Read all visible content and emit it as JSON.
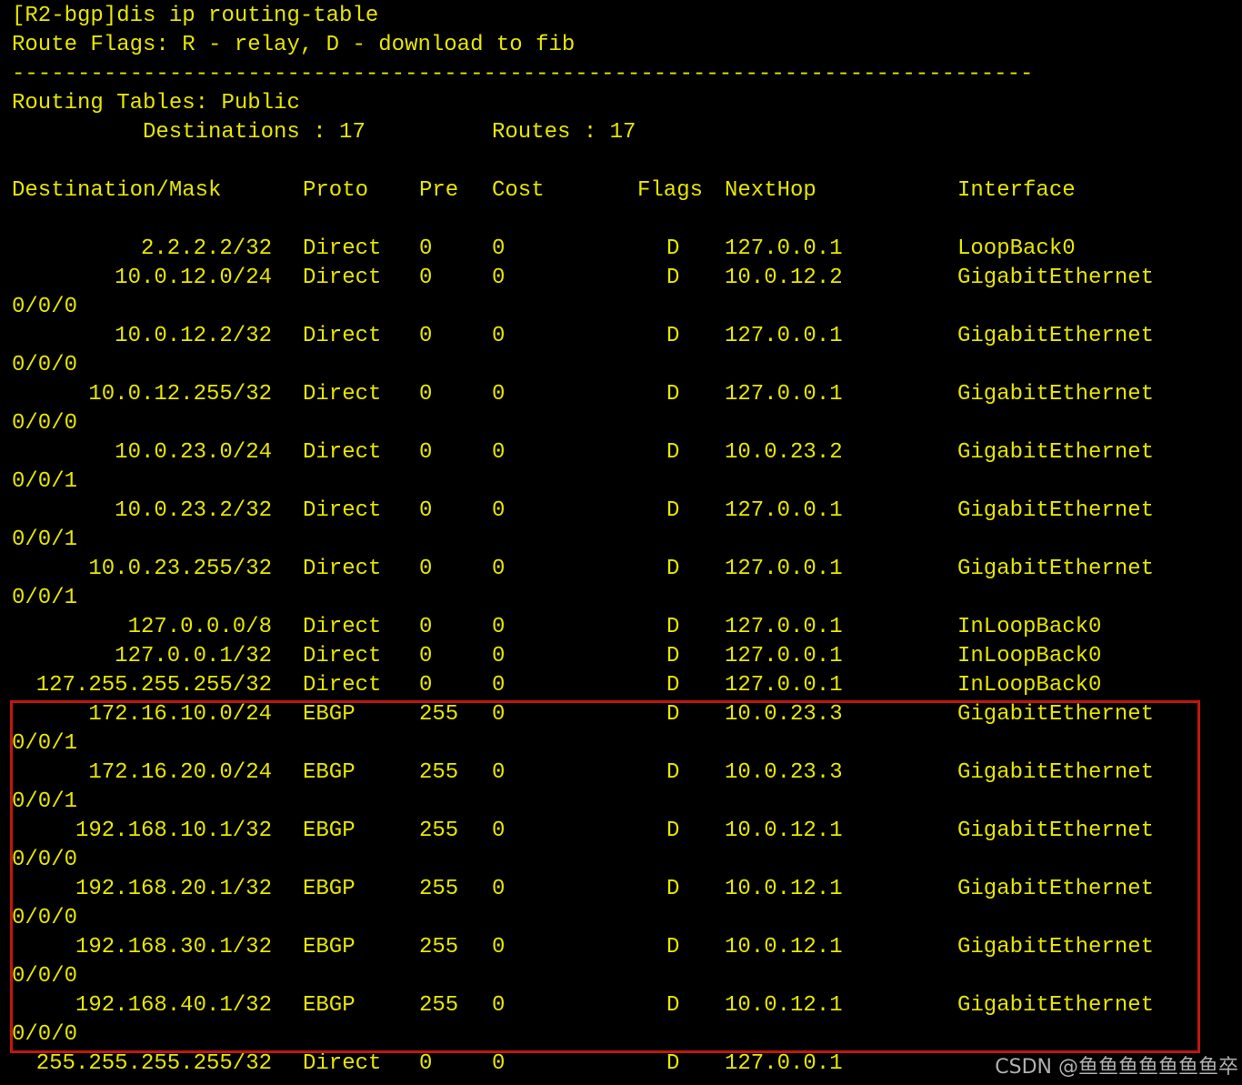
{
  "colors": {
    "background": "#000000",
    "text": "#e6e600",
    "highlight_border": "#c0170f",
    "watermark": "#b0b0b0"
  },
  "header": {
    "command": "[R2-bgp]dis ip routing-table",
    "flags_legend": "Route Flags: R - relay, D - download to fib",
    "separator": "------------------------------------------------------------------------------",
    "table_title": "Routing Tables: Public",
    "destinations_label": "Destinations : 17",
    "routes_label": "Routes : 17"
  },
  "columns": [
    "Destination/Mask",
    "Proto",
    "Pre",
    "Cost",
    "Flags",
    "NextHop",
    "Interface"
  ],
  "routes": [
    {
      "dest": "2.2.2.2/32",
      "proto": "Direct",
      "pre": "0",
      "cost": "0",
      "flags": "D",
      "nexthop": "127.0.0.1",
      "iface": "LoopBack0",
      "iface_cont": ""
    },
    {
      "dest": "10.0.12.0/24",
      "proto": "Direct",
      "pre": "0",
      "cost": "0",
      "flags": "D",
      "nexthop": "10.0.12.2",
      "iface": "GigabitEthernet",
      "iface_cont": "0/0/0"
    },
    {
      "dest": "10.0.12.2/32",
      "proto": "Direct",
      "pre": "0",
      "cost": "0",
      "flags": "D",
      "nexthop": "127.0.0.1",
      "iface": "GigabitEthernet",
      "iface_cont": "0/0/0"
    },
    {
      "dest": "10.0.12.255/32",
      "proto": "Direct",
      "pre": "0",
      "cost": "0",
      "flags": "D",
      "nexthop": "127.0.0.1",
      "iface": "GigabitEthernet",
      "iface_cont": "0/0/0"
    },
    {
      "dest": "10.0.23.0/24",
      "proto": "Direct",
      "pre": "0",
      "cost": "0",
      "flags": "D",
      "nexthop": "10.0.23.2",
      "iface": "GigabitEthernet",
      "iface_cont": "0/0/1"
    },
    {
      "dest": "10.0.23.2/32",
      "proto": "Direct",
      "pre": "0",
      "cost": "0",
      "flags": "D",
      "nexthop": "127.0.0.1",
      "iface": "GigabitEthernet",
      "iface_cont": "0/0/1"
    },
    {
      "dest": "10.0.23.255/32",
      "proto": "Direct",
      "pre": "0",
      "cost": "0",
      "flags": "D",
      "nexthop": "127.0.0.1",
      "iface": "GigabitEthernet",
      "iface_cont": "0/0/1"
    },
    {
      "dest": "127.0.0.0/8",
      "proto": "Direct",
      "pre": "0",
      "cost": "0",
      "flags": "D",
      "nexthop": "127.0.0.1",
      "iface": "InLoopBack0",
      "iface_cont": ""
    },
    {
      "dest": "127.0.0.1/32",
      "proto": "Direct",
      "pre": "0",
      "cost": "0",
      "flags": "D",
      "nexthop": "127.0.0.1",
      "iface": "InLoopBack0",
      "iface_cont": ""
    },
    {
      "dest": "127.255.255.255/32",
      "proto": "Direct",
      "pre": "0",
      "cost": "0",
      "flags": "D",
      "nexthop": "127.0.0.1",
      "iface": "InLoopBack0",
      "iface_cont": ""
    },
    {
      "dest": "172.16.10.0/24",
      "proto": "EBGP",
      "pre": "255",
      "cost": "0",
      "flags": "D",
      "nexthop": "10.0.23.3",
      "iface": "GigabitEthernet",
      "iface_cont": "0/0/1"
    },
    {
      "dest": "172.16.20.0/24",
      "proto": "EBGP",
      "pre": "255",
      "cost": "0",
      "flags": "D",
      "nexthop": "10.0.23.3",
      "iface": "GigabitEthernet",
      "iface_cont": "0/0/1"
    },
    {
      "dest": "192.168.10.1/32",
      "proto": "EBGP",
      "pre": "255",
      "cost": "0",
      "flags": "D",
      "nexthop": "10.0.12.1",
      "iface": "GigabitEthernet",
      "iface_cont": "0/0/0"
    },
    {
      "dest": "192.168.20.1/32",
      "proto": "EBGP",
      "pre": "255",
      "cost": "0",
      "flags": "D",
      "nexthop": "10.0.12.1",
      "iface": "GigabitEthernet",
      "iface_cont": "0/0/0"
    },
    {
      "dest": "192.168.30.1/32",
      "proto": "EBGP",
      "pre": "255",
      "cost": "0",
      "flags": "D",
      "nexthop": "10.0.12.1",
      "iface": "GigabitEthernet",
      "iface_cont": "0/0/0"
    },
    {
      "dest": "192.168.40.1/32",
      "proto": "EBGP",
      "pre": "255",
      "cost": "0",
      "flags": "D",
      "nexthop": "10.0.12.1",
      "iface": "GigabitEthernet",
      "iface_cont": "0/0/0"
    },
    {
      "dest": "255.255.255.255/32",
      "proto": "Direct",
      "pre": "0",
      "cost": "0",
      "flags": "D",
      "nexthop": "127.0.0.1",
      "iface": "",
      "iface_cont": ""
    }
  ],
  "watermark": "CSDN @鱼鱼鱼鱼鱼鱼鱼卒"
}
